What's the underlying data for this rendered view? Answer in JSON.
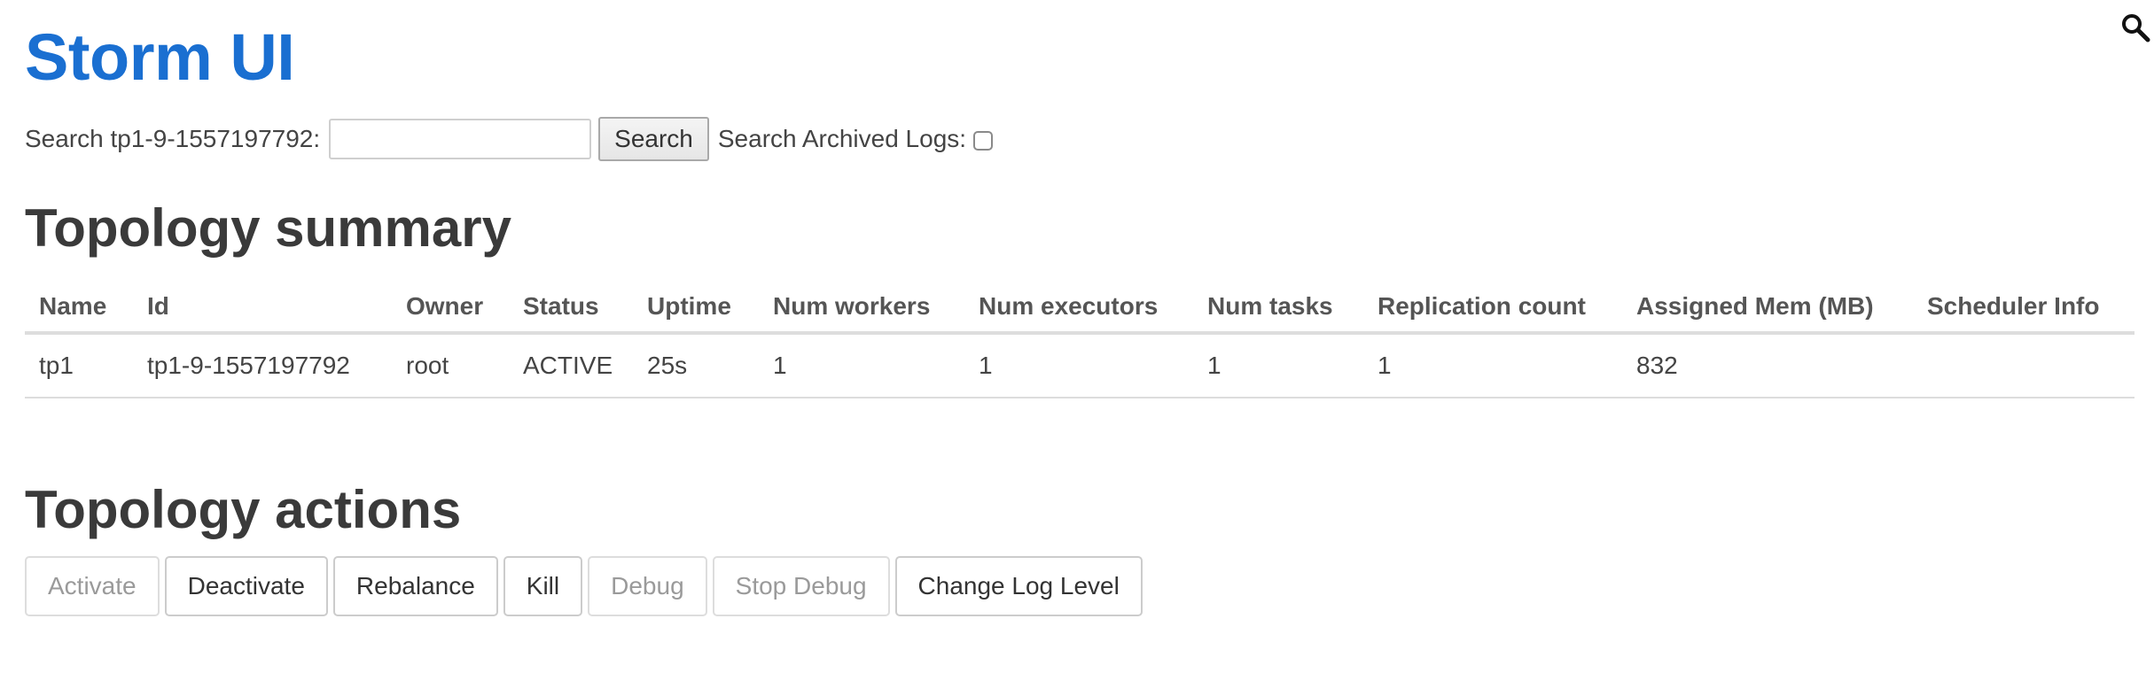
{
  "header": {
    "title": "Storm UI",
    "corner_icon": "search-icon"
  },
  "search": {
    "label": "Search tp1-9-1557197792:",
    "value": "",
    "placeholder": "",
    "button_label": "Search",
    "archived_label": "Search Archived Logs:",
    "archived_checked": false
  },
  "summary": {
    "heading": "Topology summary",
    "columns": [
      "Name",
      "Id",
      "Owner",
      "Status",
      "Uptime",
      "Num workers",
      "Num executors",
      "Num tasks",
      "Replication count",
      "Assigned Mem (MB)",
      "Scheduler Info"
    ],
    "rows": [
      [
        "tp1",
        "tp1-9-1557197792",
        "root",
        "ACTIVE",
        "25s",
        "1",
        "1",
        "1",
        "1",
        "832",
        ""
      ]
    ]
  },
  "actions": {
    "heading": "Topology actions",
    "buttons": [
      {
        "label": "Activate",
        "enabled": false
      },
      {
        "label": "Deactivate",
        "enabled": true
      },
      {
        "label": "Rebalance",
        "enabled": true
      },
      {
        "label": "Kill",
        "enabled": true
      },
      {
        "label": "Debug",
        "enabled": false
      },
      {
        "label": "Stop Debug",
        "enabled": false
      },
      {
        "label": "Change Log Level",
        "enabled": true
      }
    ]
  },
  "colors": {
    "title": "#1a6fd1",
    "heading": "#3a3a3a",
    "disabled_text": "#9a9a9a"
  }
}
